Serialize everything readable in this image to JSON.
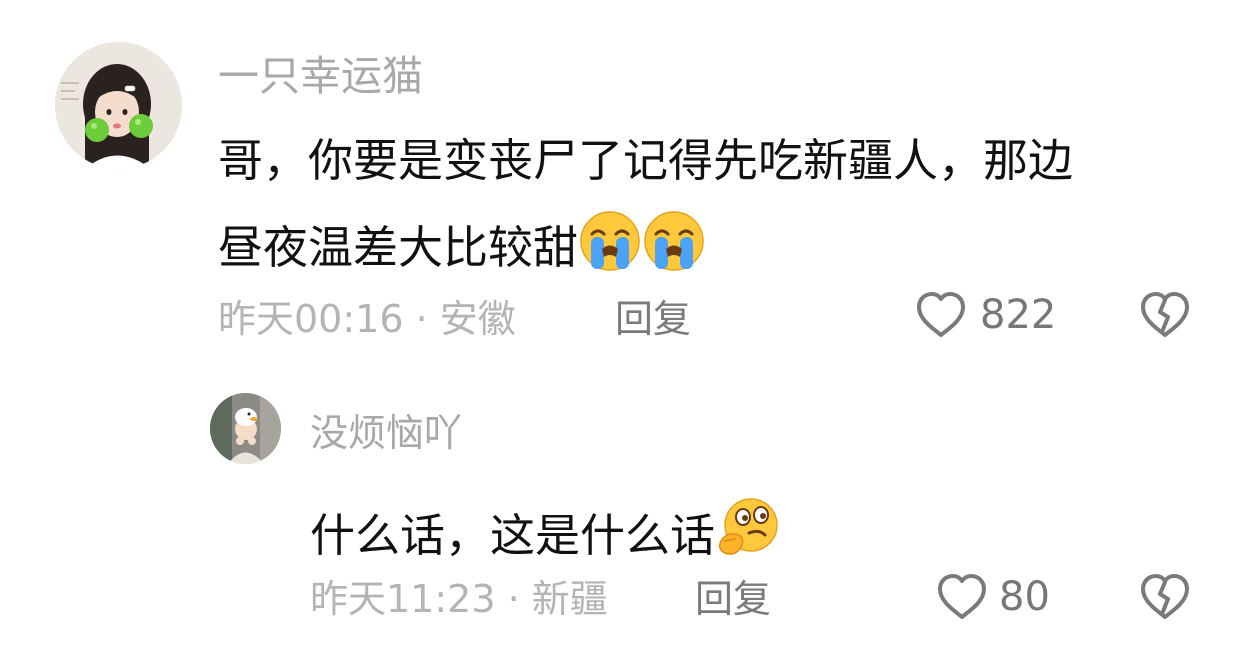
{
  "comments": [
    {
      "username": "一只幸运猫",
      "content_line1": "哥，你要是变丧尸了记得先吃新疆人，那边",
      "content_line2": "昼夜温差大比较甜",
      "content_emojis": [
        "loudly-crying-face-emoji",
        "loudly-crying-face-emoji"
      ],
      "meta": "昨天00:16 · 安徽",
      "reply_label": "回复",
      "like_count": "822",
      "avatar_icon": "girl-holding-green-apples-avatar"
    },
    {
      "username": "没烦恼吖",
      "content_line1": "什么话，这是什么话",
      "content_emojis": [
        "thinking-face-emoji"
      ],
      "meta": "昨天11:23 · 新疆",
      "reply_label": "回复",
      "like_count": "80",
      "avatar_icon": "person-with-duck-hat-avatar"
    }
  ],
  "colors": {
    "username": "#a8a8a8",
    "content": "#111111",
    "meta": "#b4b4b4",
    "reply": "#7a7a7a",
    "icon_stroke": "#7a7a7a"
  }
}
